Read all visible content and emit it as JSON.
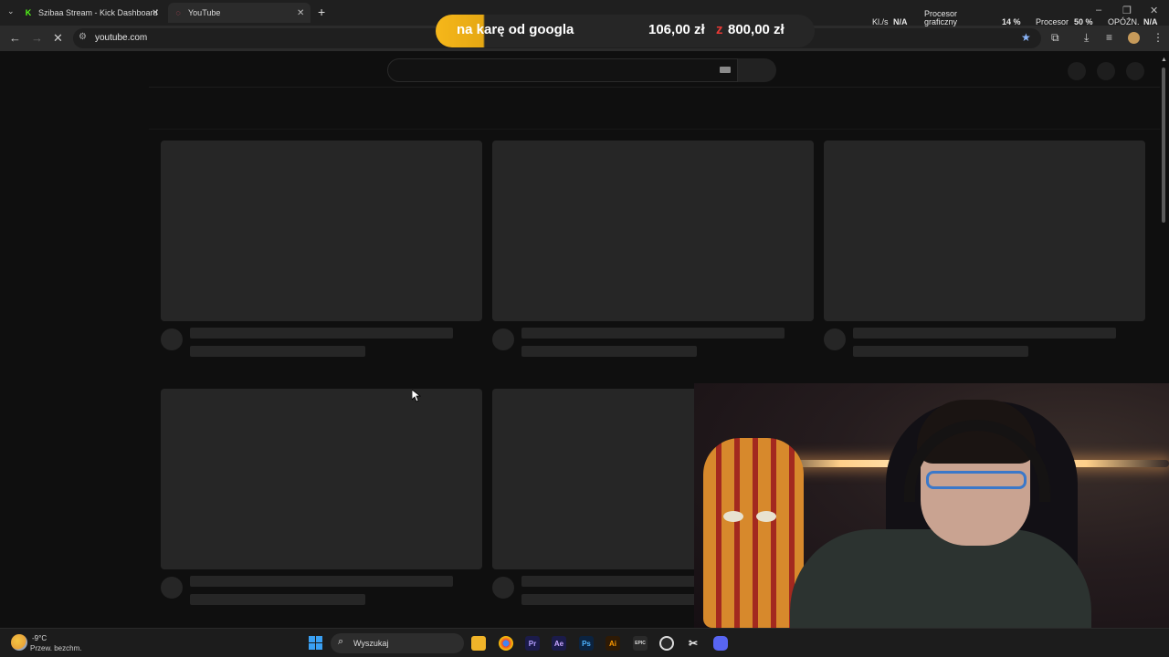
{
  "browser": {
    "tabs": [
      {
        "title": "Szibaa Stream - Kick Dashboard",
        "favicon": "kick-icon",
        "color": "#53fc18"
      },
      {
        "title": "YouTube",
        "favicon": "youtube-loading-icon",
        "color": "#ff4e6a"
      }
    ],
    "address": "youtube.com"
  },
  "overlay": {
    "donation_label": "na karę od googla",
    "amount": "106,00 zł",
    "separator": "z",
    "goal": "800,00 zł",
    "accent": "#f6b71a"
  },
  "stats": {
    "kls_label": "Kl./s",
    "kls_value": "N/A",
    "gpu_label_1": "Procesor",
    "gpu_label_2": "graficzny",
    "gpu_value": "14 %",
    "cpu_label": "Procesor",
    "cpu_value": "50 %",
    "latency_label": "OPÓŹN.",
    "latency_value": "N/A"
  },
  "taskbar": {
    "temperature": "-9°C",
    "weather": "Przew. bezchm.",
    "search_placeholder": "Wyszukaj",
    "apps": [
      {
        "name": "file-explorer-icon",
        "label": ""
      },
      {
        "name": "chrome-icon",
        "label": ""
      },
      {
        "name": "premiere-icon",
        "label": "Pr"
      },
      {
        "name": "after-effects-icon",
        "label": "Ae"
      },
      {
        "name": "photoshop-icon",
        "label": "Ps"
      },
      {
        "name": "illustrator-icon",
        "label": "Ai"
      },
      {
        "name": "epic-games-icon",
        "label": "EPIC"
      },
      {
        "name": "obs-icon",
        "label": ""
      },
      {
        "name": "capcut-icon",
        "label": ""
      },
      {
        "name": "discord-icon",
        "label": ""
      }
    ]
  }
}
